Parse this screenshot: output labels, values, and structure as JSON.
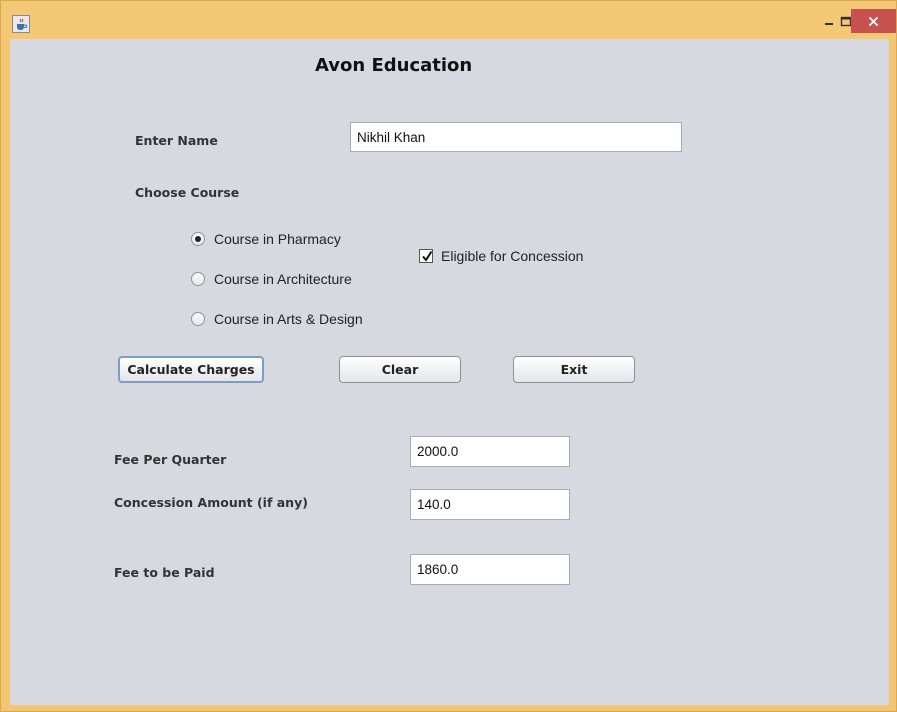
{
  "window": {
    "icon": "java-coffee-icon",
    "controls": {
      "minimize": "minimize-icon",
      "maximize": "maximize-icon",
      "close": "close-icon"
    }
  },
  "form": {
    "heading": "Avon Education",
    "name_label": "Enter Name",
    "name_value": "Nikhil Khan",
    "course_label": "Choose Course",
    "courses": [
      {
        "label": "Course in Pharmacy",
        "selected": true
      },
      {
        "label": "Course in Architecture",
        "selected": false
      },
      {
        "label": "Course in Arts & Design",
        "selected": false
      }
    ],
    "concession_checkbox": {
      "label": "Eligible for Concession",
      "checked": true
    },
    "buttons": {
      "calculate": "Calculate Charges",
      "clear": "Clear",
      "exit": "Exit"
    },
    "fee_per_quarter_label": "Fee Per Quarter",
    "fee_per_quarter_value": "2000.0",
    "concession_label": "Concession Amount (if any)",
    "concession_value": "140.0",
    "fee_to_pay_label": "Fee to be Paid",
    "fee_to_pay_value": "1860.0"
  },
  "colors": {
    "title_bar": "#f5c875",
    "close_button": "#c75050",
    "panel": "#d6d9df"
  }
}
